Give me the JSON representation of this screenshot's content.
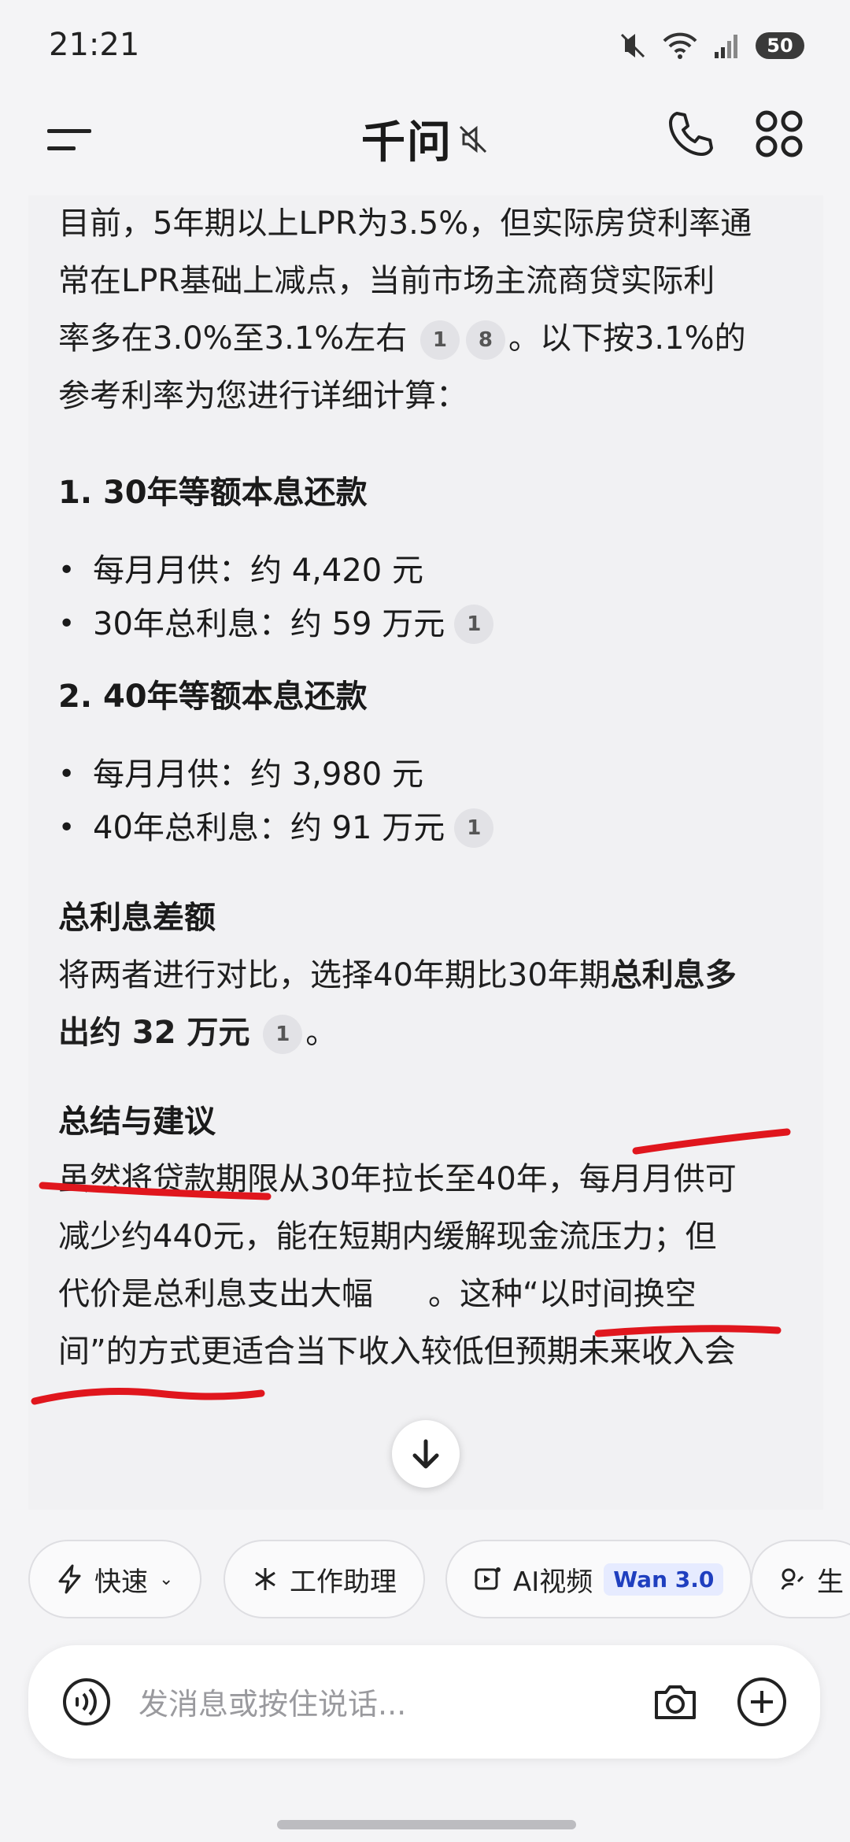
{
  "status": {
    "time": "21:21",
    "battery": "50"
  },
  "header": {
    "title": "千问"
  },
  "content": {
    "intro": [
      "目前，5年期以上LPR为3.5%，但实际房贷利率通",
      "常在LPR基础上减点，当前市场主流商贷实际利",
      "率多在3.0%至3.1%左右",
      "。以下按3.1%的",
      "参考利率为您进行详细计算："
    ],
    "cite_a": "1",
    "cite_b": "8",
    "s1_title": "1. 30年等额本息还款",
    "s1_items": [
      "每月月供：约 4,420 元",
      "30年总利息：约 59 万元"
    ],
    "s2_title": "2. 40年等额本息还款",
    "s2_items": [
      "每月月供：约 3,980 元",
      "40年总利息：约 91 万元"
    ],
    "diff_title": "总利息差额",
    "diff_line1": "将两者进行对比，选择40年期比30年期",
    "diff_bold1": "总利息多",
    "diff_bold2": "出约 32 万元",
    "diff_end": "。",
    "sum_title": "总结与建议",
    "sum_line1": "虽然将贷款期限从30年拉长至40年，",
    "sum_line1b": "每月月供可",
    "sum_line2a": "减少约440元",
    "sum_line2b": "，能在短期内缓解现金流压力；但",
    "sum_line3": "代价是总利息支出大幅",
    "sum_line3b": "。这种“以时间换空",
    "sum_line4": "间”的方式更适合当下收入较低但预期未来收入会"
  },
  "chips": [
    {
      "label": "快速"
    },
    {
      "label": "工作助理"
    },
    {
      "label": "AI视频",
      "badge": "Wan 3.0"
    },
    {
      "label": "生"
    }
  ],
  "input": {
    "placeholder": "发消息或按住说话..."
  },
  "colors": {
    "annotation": "#e0161d",
    "badge_text": "#1f3fbf"
  }
}
